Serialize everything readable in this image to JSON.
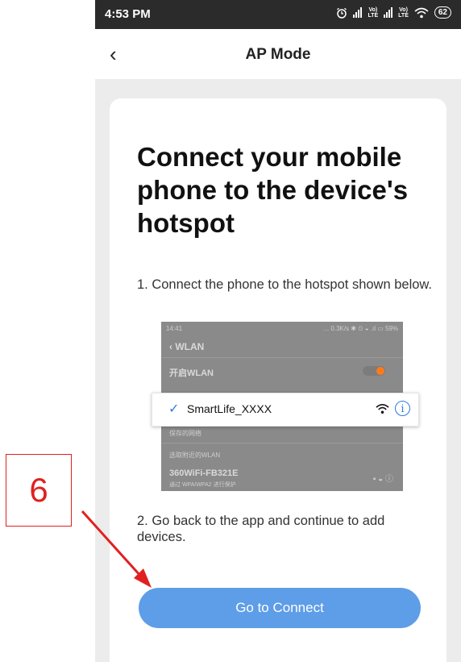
{
  "status_bar": {
    "time": "4:53 PM",
    "battery": "62",
    "lte_label": "LTE",
    "volte_label": "Vo)"
  },
  "nav": {
    "title": "AP Mode",
    "back_glyph": "‹"
  },
  "card": {
    "heading": "Connect your mobile phone to the device's hotspot",
    "step1": "1. Connect the phone to the hotspot shown below.",
    "step2": "2. Go back to the app and continue to add devices.",
    "connect_button": "Go to Connect"
  },
  "illustration": {
    "time": "14:41",
    "status": "... 0.3K/s ✱ ⏲ ◒ .ıl ▭ 59%",
    "title": "‹  WLAN",
    "wlan_toggle_label": "开启WLAN",
    "saved_label": "保存的网络",
    "available_label": "选取附近的WLAN",
    "network_name": "360WiFi-FB321E",
    "network_detail": "通过 WPA/WPA2 进行保护",
    "network_icons": "▪  ◒    ⓘ",
    "selected_ssid": "SmartLife_XXXX",
    "check_glyph": "✓",
    "info_glyph": "i"
  },
  "annotation": {
    "step_number": "6"
  },
  "colors": {
    "accent": "#5e9de8",
    "annotation": "#e02020",
    "statusbar": "#2b2b2b",
    "link_blue": "#2f7bdc"
  },
  "icons": [
    "alarm-icon",
    "signal-icon",
    "wifi-icon",
    "battery-icon",
    "back-chevron-icon",
    "checkmark-icon",
    "info-icon",
    "arrow-icon"
  ]
}
